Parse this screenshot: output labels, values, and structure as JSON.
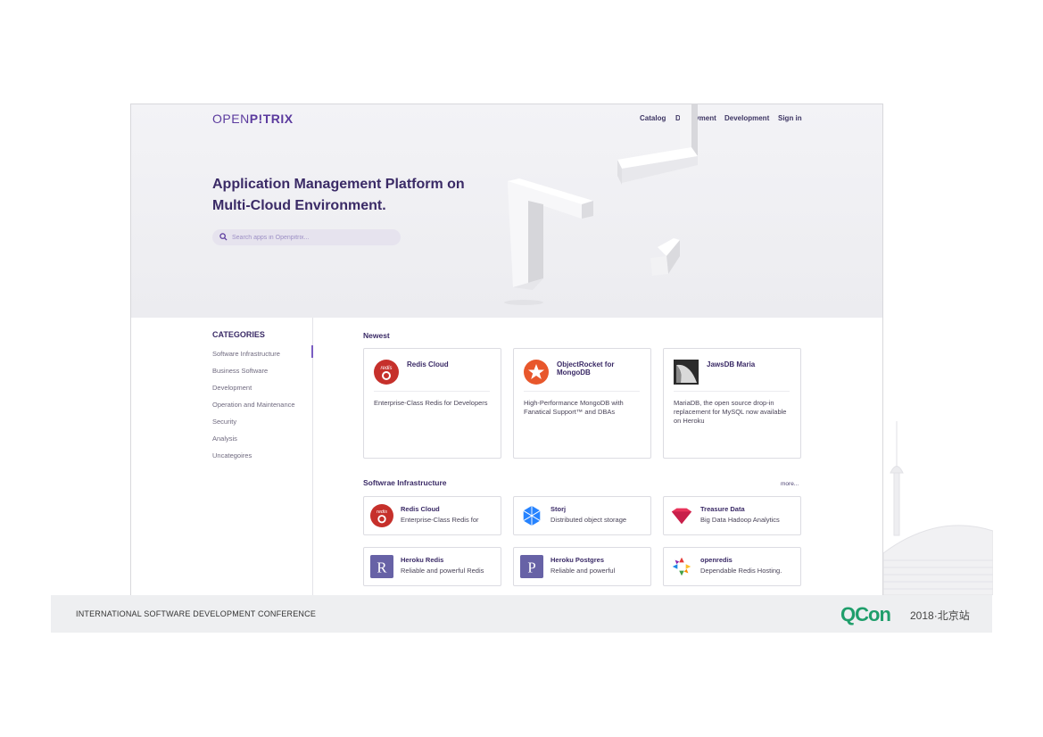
{
  "header": {
    "logo_prefix": "OPEN",
    "logo_suffix": "P!TRIX",
    "nav": [
      "Catalog",
      "Deployment",
      "Development",
      "Sign in"
    ]
  },
  "hero": {
    "title_line1": "Application Management Platform on",
    "title_line2": "Multi-Cloud Environment.",
    "search_placeholder": "Search apps in Openpitrix..."
  },
  "sidebar": {
    "title": "CATEGORIES",
    "items": [
      "Software Infrastructure",
      "Business Software",
      "Development",
      "Operation and Maintenance",
      "Security",
      "Analysis",
      "Uncategoires"
    ],
    "active_index": 0
  },
  "newest": {
    "title": "Newest",
    "cards": [
      {
        "name": "Redis Cloud",
        "desc": "Enterprise-Class Redis for Developers",
        "icon": "redis-cloud-icon"
      },
      {
        "name": "ObjectRocket for MongoDB",
        "desc": "High-Performance MongoDB with Fanatical Support™ and DBAs",
        "icon": "objectrocket-icon"
      },
      {
        "name": "JawsDB Maria",
        "desc": "MariaDB, the open source drop-in replacement for MySQL now available on Heroku",
        "icon": "jawsdb-icon"
      }
    ]
  },
  "infra": {
    "title": "Softwrae Infrastructure",
    "more": "more...",
    "cards": [
      {
        "name": "Redis Cloud",
        "desc": "Enterprise-Class Redis for",
        "icon": "redis-cloud-icon"
      },
      {
        "name": "Storj",
        "desc": "Distributed object storage",
        "icon": "storj-icon"
      },
      {
        "name": "Treasure Data",
        "desc": "Big Data Hadoop Analytics",
        "icon": "treasure-data-icon"
      },
      {
        "name": "Heroku Redis",
        "desc": "Reliable and powerful Redis",
        "icon": "heroku-redis-icon"
      },
      {
        "name": "Heroku Postgres",
        "desc": "Reliable and powerful",
        "icon": "heroku-postgres-icon"
      },
      {
        "name": "openredis",
        "desc": "Dependable Redis Hosting.",
        "icon": "openredis-icon"
      }
    ]
  },
  "footer": {
    "conference": "INTERNATIONAL SOFTWARE DEVELOPMENT CONFERENCE",
    "brand": "QCon",
    "edition": "2018·北京站"
  },
  "colors": {
    "accent": "#5b3a9e",
    "heading": "#3a2a66",
    "qcon_green": "#1f9e6b"
  }
}
